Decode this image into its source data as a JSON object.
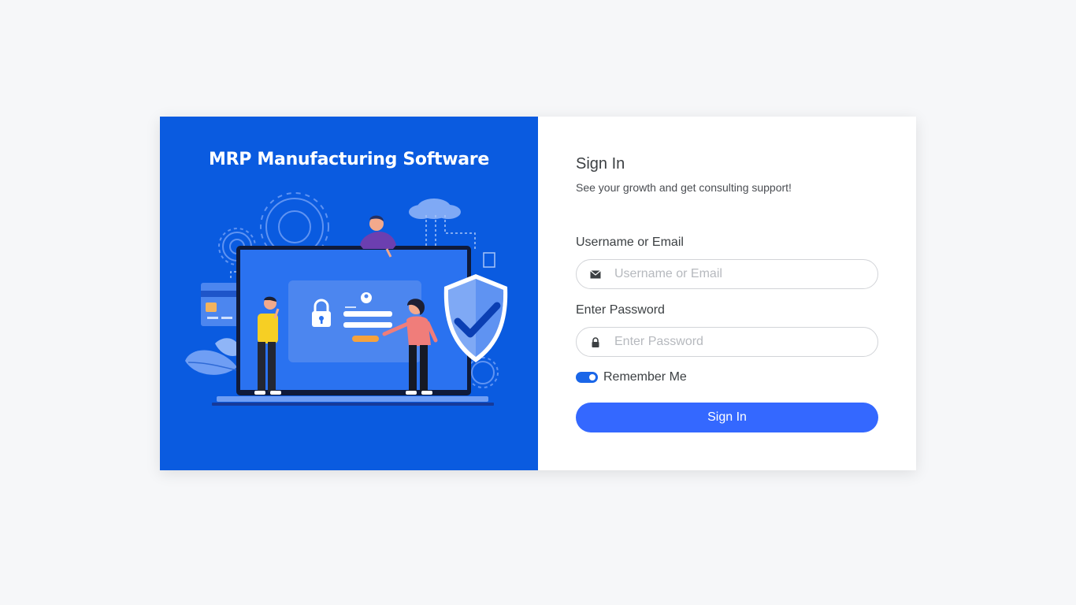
{
  "hero": {
    "title": "MRP Manufacturing Software",
    "background": "#0a5be0"
  },
  "signin": {
    "title": "Sign In",
    "subtitle": "See your growth and get consulting support!",
    "username_label": "Username or Email",
    "username_placeholder": "Username or Email",
    "username_value": "",
    "username_icon": "envelope-icon",
    "password_label": "Enter Password",
    "password_placeholder": "Enter Password",
    "password_value": "",
    "password_icon": "lock-icon",
    "remember_label": "Remember Me",
    "remember_checked": true,
    "submit_label": "Sign In",
    "accent": "#3468ff"
  }
}
